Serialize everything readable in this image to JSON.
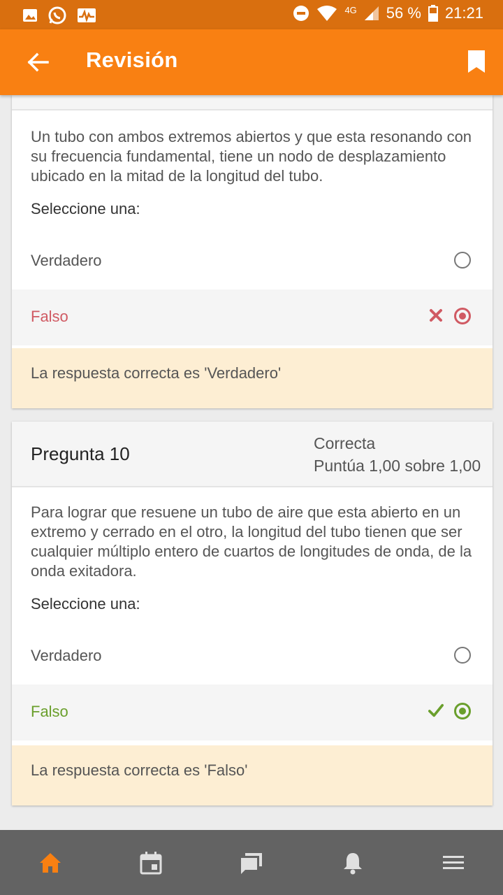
{
  "status_bar": {
    "battery": "56 %",
    "time": "21:21",
    "network": "4G"
  },
  "app_bar": {
    "title": "Revisión",
    "back_icon": "arrow-left-icon",
    "bookmark_icon": "bookmark-icon"
  },
  "question_9": {
    "text": "Un tubo con ambos extremos abiertos y que esta resonando con su frecuencia fundamental, tiene un nodo de desplazamiento ubicado en la mitad de la longitud del tubo.",
    "prompt": "Seleccione una:",
    "options": [
      {
        "label": "Verdadero",
        "selected": false
      },
      {
        "label": "Falso",
        "selected": true,
        "result": "incorrect"
      }
    ],
    "feedback": "La respuesta correcta es 'Verdadero'"
  },
  "question_10": {
    "name": "Pregunta 10",
    "state": "Correcta",
    "grade": "Puntúa 1,00 sobre 1,00",
    "text": "Para lograr que resuene un tubo de aire que esta abierto en un extremo y cerrado en el otro, la longitud del tubo tienen que ser cualquier múltiplo entero de cuartos de longitudes de onda, de la onda exitadora.",
    "prompt": "Seleccione una:",
    "options": [
      {
        "label": "Verdadero",
        "selected": false
      },
      {
        "label": "Falso",
        "selected": true,
        "result": "correct"
      }
    ],
    "feedback": "La respuesta correcta es 'Falso'"
  },
  "colors": {
    "accent": "#f98012",
    "incorrect": "#d05a63",
    "correct": "#6a9f2c",
    "feedback_bg": "#fdeed3"
  },
  "bottom_nav": {
    "items": [
      {
        "icon": "home-icon",
        "active": true
      },
      {
        "icon": "calendar-icon",
        "active": false
      },
      {
        "icon": "messages-icon",
        "active": false
      },
      {
        "icon": "bell-icon",
        "active": false
      },
      {
        "icon": "menu-icon",
        "active": false
      }
    ]
  }
}
